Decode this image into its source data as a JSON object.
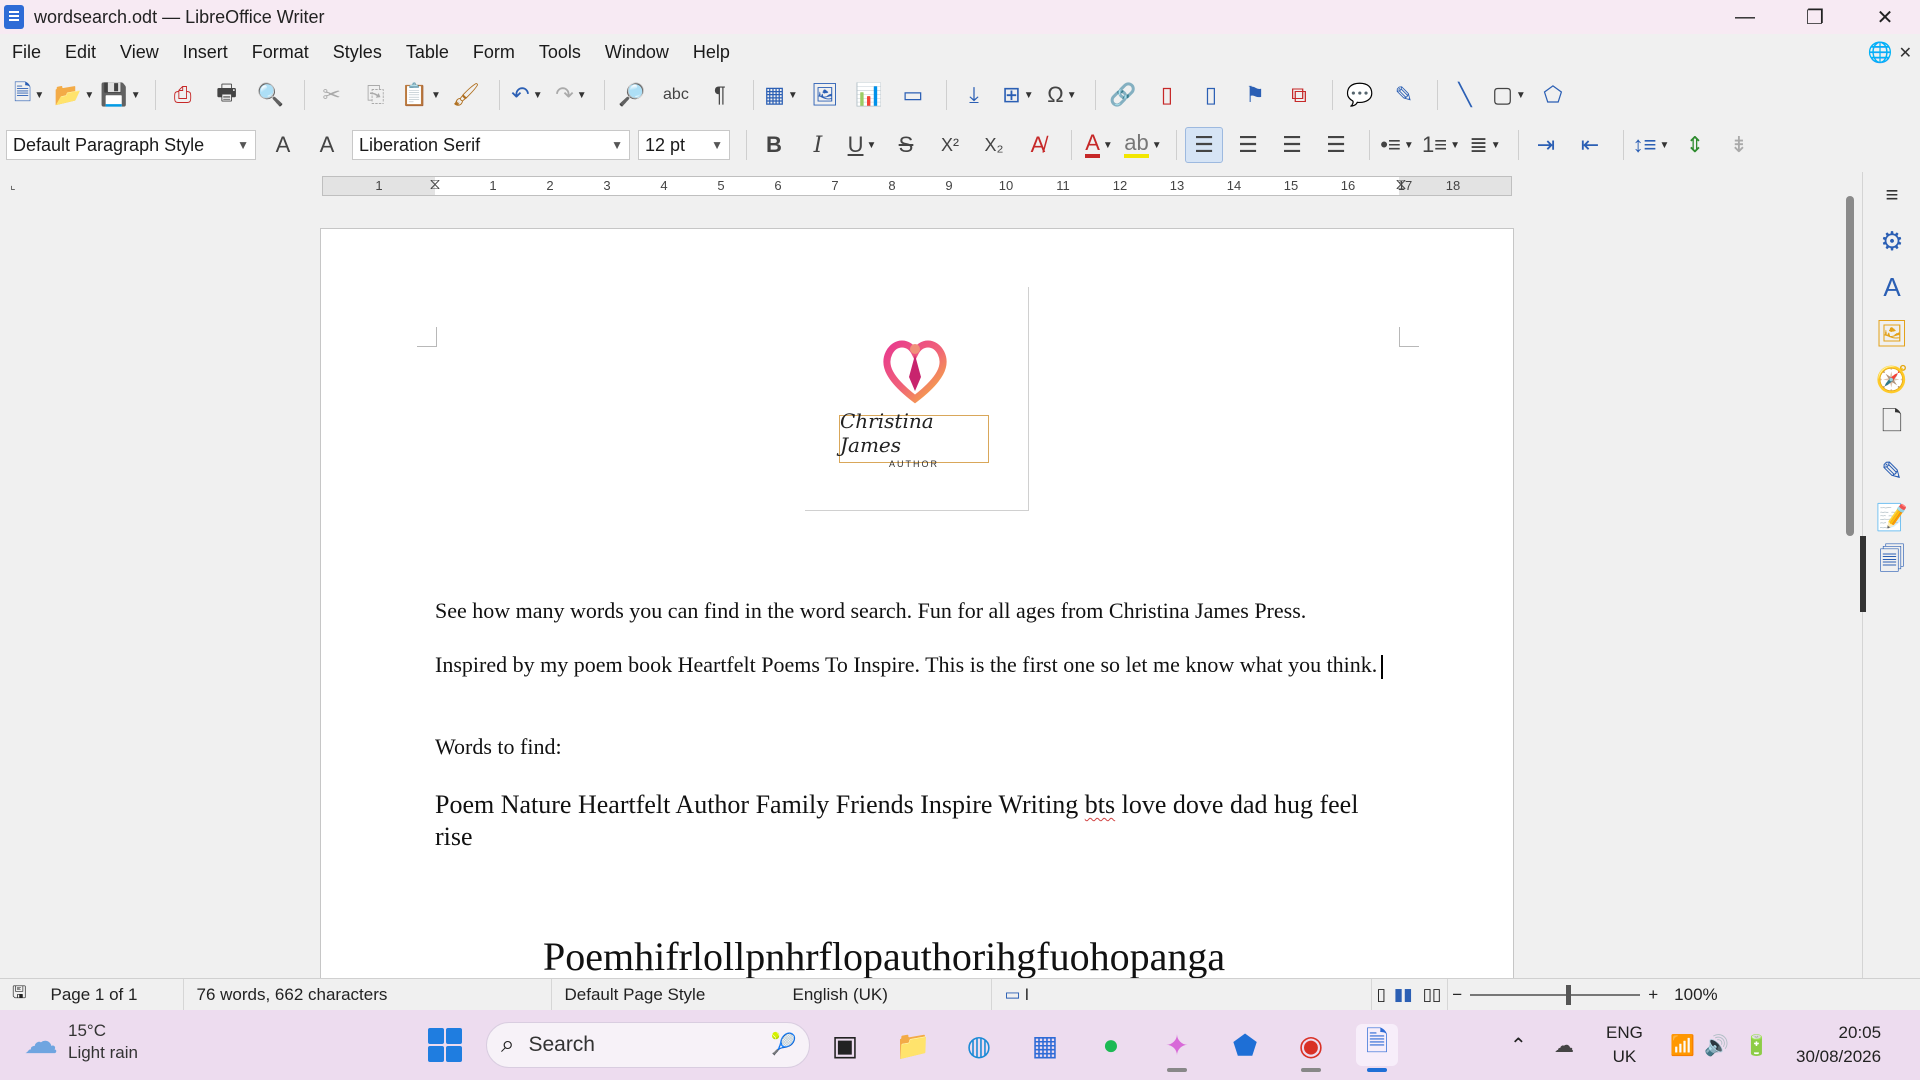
{
  "window": {
    "title": "wordsearch.odt — LibreOffice Writer",
    "minimize": "—",
    "restore": "❐",
    "close": "✕"
  },
  "menu": [
    "File",
    "Edit",
    "View",
    "Insert",
    "Format",
    "Styles",
    "Table",
    "Form",
    "Tools",
    "Window",
    "Help"
  ],
  "formatting": {
    "paragraph_style": "Default Paragraph Style",
    "font_name": "Liberation Serif",
    "font_size": "12 pt",
    "bold": "B",
    "italic": "I",
    "underline": "U",
    "strike": "S",
    "superscript": "X²",
    "subscript": "X₂"
  },
  "ruler": {
    "ticks": [
      "1",
      "1",
      "2",
      "3",
      "4",
      "5",
      "6",
      "7",
      "8",
      "9",
      "10",
      "11",
      "12",
      "13",
      "14",
      "15",
      "16",
      "17",
      "18"
    ]
  },
  "logo": {
    "name": "Christina James",
    "subtitle": "AUTHOR"
  },
  "document": {
    "para1": "See how many words you can find in the word search. Fun for all ages from Christina James Press.",
    "para2": "Inspired by my poem book Heartfelt Poems To Inspire. This is the first one so let me know what you think.",
    "para3": "Words to find:",
    "words_before": "Poem Nature Heartfelt Author Family Friends Inspire Writing ",
    "words_misspelled": "bts",
    "words_after": " love dove dad hug feel rise",
    "grid_line": "Poemhifrlollpnhrflopauthorihgfuohopanga"
  },
  "status": {
    "page": "Page 1 of 1",
    "words": "76 words, 662 characters",
    "page_style": "Default Page Style",
    "language": "English (UK)",
    "zoom": "100%"
  },
  "taskbar": {
    "temperature": "15°C",
    "weather": "Light rain",
    "search_placeholder": "Search",
    "lang_line1": "ENG",
    "lang_line2": "UK",
    "time": "20:05",
    "date": "30/08/2026"
  },
  "colors": {
    "accent": "#2b5fb4",
    "titlebar": "#f7eaf3",
    "taskbar": "#eddcef"
  }
}
